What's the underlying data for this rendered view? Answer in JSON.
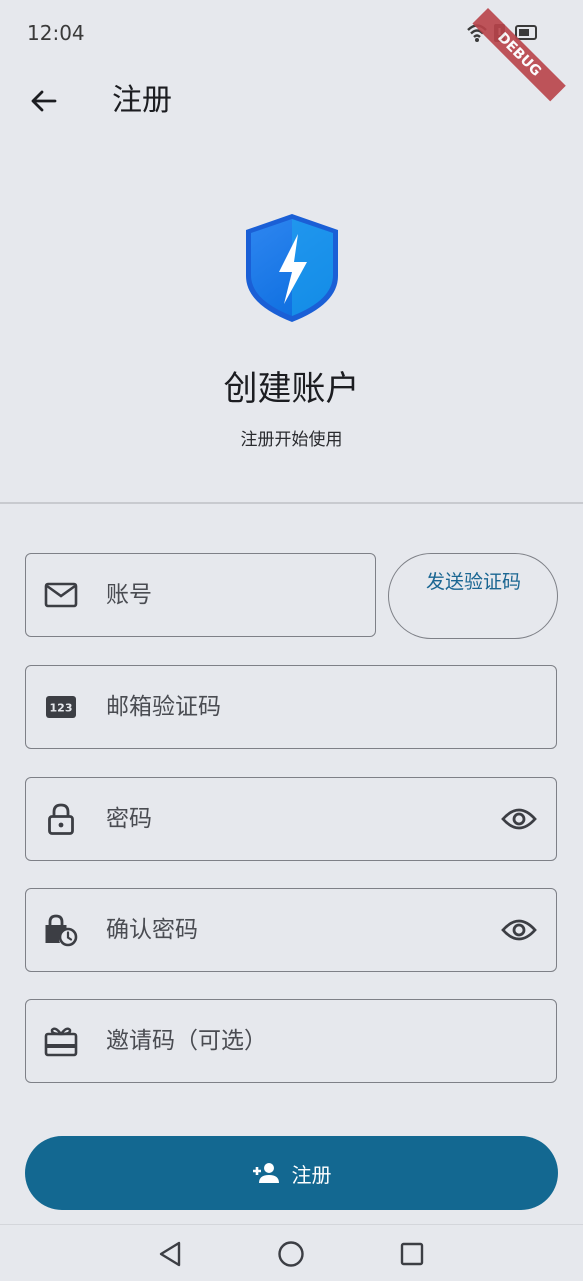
{
  "status": {
    "time": "12:04",
    "debug_banner": "DEBUG"
  },
  "app_bar": {
    "title": "注册"
  },
  "hero": {
    "title": "创建账户",
    "subtitle": "注册开始使用"
  },
  "form": {
    "account": {
      "placeholder": "账号",
      "value": ""
    },
    "send_code_label": "发送验证码",
    "email_code": {
      "placeholder": "邮箱验证码",
      "value": "",
      "icon_text": "123"
    },
    "password": {
      "placeholder": "密码",
      "value": ""
    },
    "confirm_password": {
      "placeholder": "确认密码",
      "value": ""
    },
    "invite_code": {
      "placeholder": "邀请码（可选）",
      "value": ""
    }
  },
  "register_button": {
    "label": "注册"
  },
  "colors": {
    "accent": "#136891",
    "link": "#1a6692",
    "background": "#e6e8ed",
    "border": "#7e8087"
  },
  "icons": [
    "arrow-left-icon",
    "shield-bolt-logo",
    "mail-icon",
    "number-123-icon",
    "lock-icon",
    "lock-clock-icon",
    "gift-card-icon",
    "eye-icon",
    "person-add-icon",
    "nav-back-icon",
    "nav-home-icon",
    "nav-recents-icon"
  ]
}
